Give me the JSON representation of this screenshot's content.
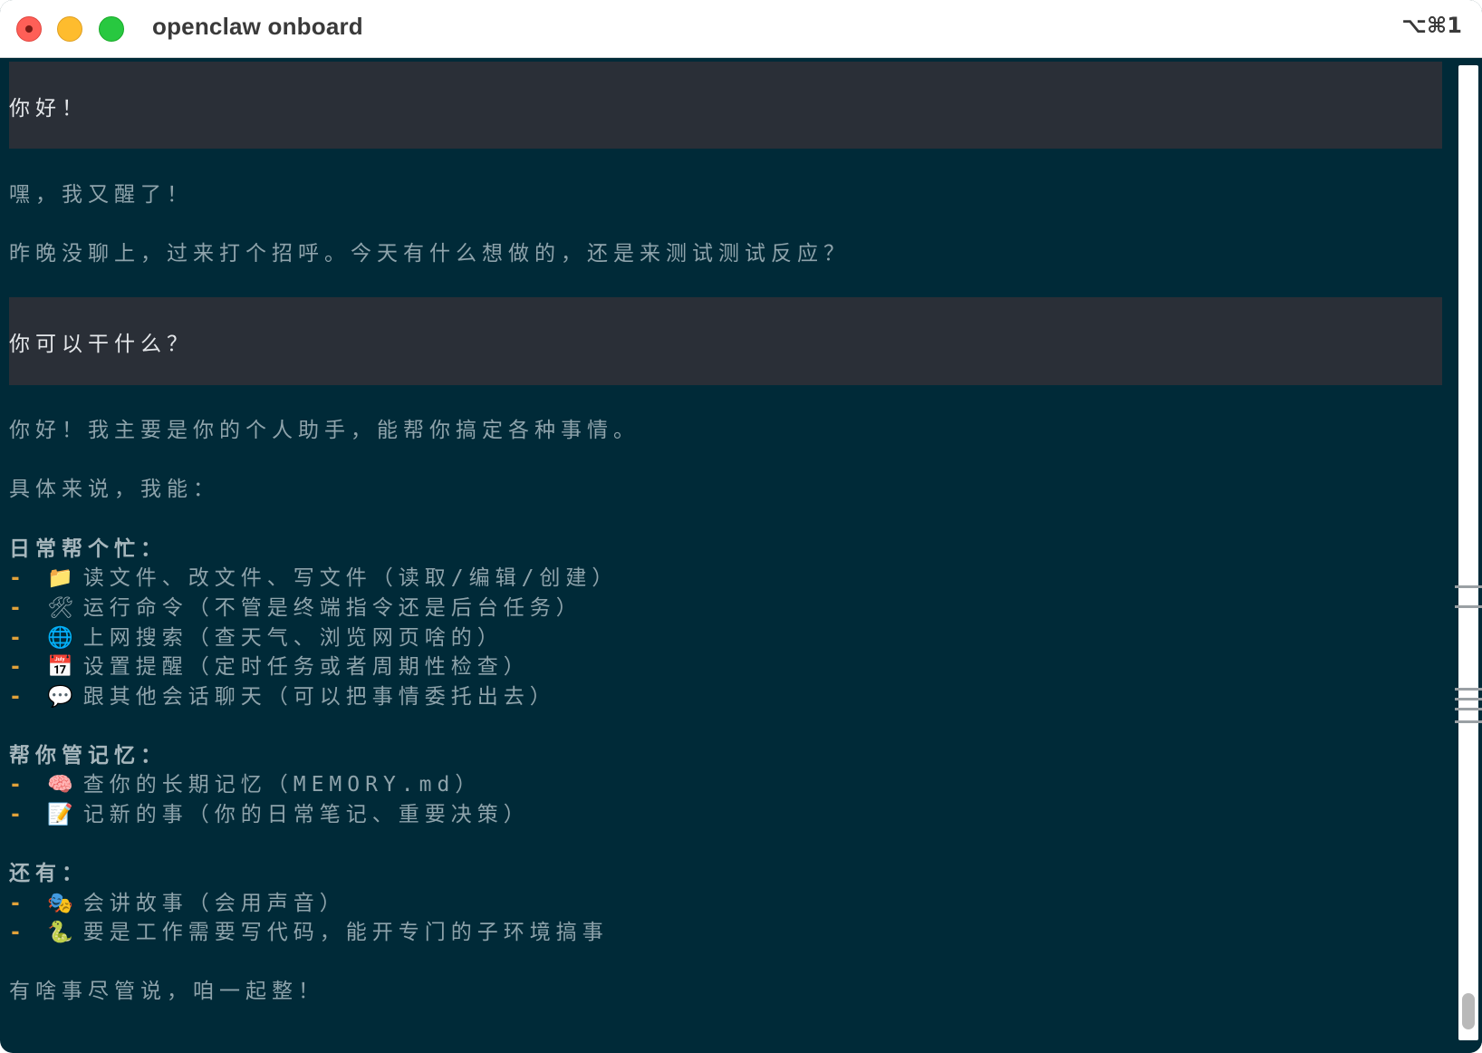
{
  "window": {
    "title": "openclaw onboard",
    "shortcut": "⌥⌘1"
  },
  "colors": {
    "terminal_bg": "#002a38",
    "user_block_bg": "#2a2f37",
    "bullet_dash": "#e2a23a"
  },
  "conversation": {
    "user_1": "你好！",
    "reply_1": {
      "line_1": "嘿，我又醒了！",
      "line_2": "昨晚没聊上，过来打个招呼。今天有什么想做的，还是来测试测试反应？"
    },
    "user_2": "你可以干什么？",
    "reply_2": {
      "intro": "你好！我主要是你的个人助手，能帮你搞定各种事情。",
      "lead": "具体来说，我能：",
      "section_1": {
        "heading": "日常帮个忙：",
        "items": [
          {
            "dash": "-",
            "emoji": "📁",
            "icon": "folder-icon",
            "text": "读文件、改文件、写文件（读取/编辑/创建）"
          },
          {
            "dash": "-",
            "emoji": "🛠",
            "icon": "tools-icon",
            "text": "运行命令（不管是终端指令还是后台任务）"
          },
          {
            "dash": "-",
            "emoji": "🌐",
            "icon": "globe-icon",
            "text": "上网搜索（查天气、浏览网页啥的）"
          },
          {
            "dash": "-",
            "emoji": "📅",
            "icon": "calendar-icon",
            "text": "设置提醒（定时任务或者周期性检查）"
          },
          {
            "dash": "-",
            "emoji": "💬",
            "icon": "speech-bubble-icon",
            "text": "跟其他会话聊天（可以把事情委托出去）"
          }
        ]
      },
      "section_2": {
        "heading": "帮你管记忆：",
        "items": [
          {
            "dash": "-",
            "emoji": "🧠",
            "icon": "brain-icon",
            "text": "查你的长期记忆（MEMORY.md）"
          },
          {
            "dash": "-",
            "emoji": "📝",
            "icon": "memo-icon",
            "text": "记新的事（你的日常笔记、重要决策）"
          }
        ]
      },
      "section_3": {
        "heading": "还有：",
        "items": [
          {
            "dash": "-",
            "emoji": "🎭",
            "icon": "theater-masks-icon",
            "text": "会讲故事（会用声音）"
          },
          {
            "dash": "-",
            "emoji": "🐍",
            "icon": "snake-icon",
            "text": "要是工作需要写代码，能开专门的子环境搞事"
          }
        ]
      },
      "closing": "有啥事尽管说，咱一起整！"
    }
  }
}
